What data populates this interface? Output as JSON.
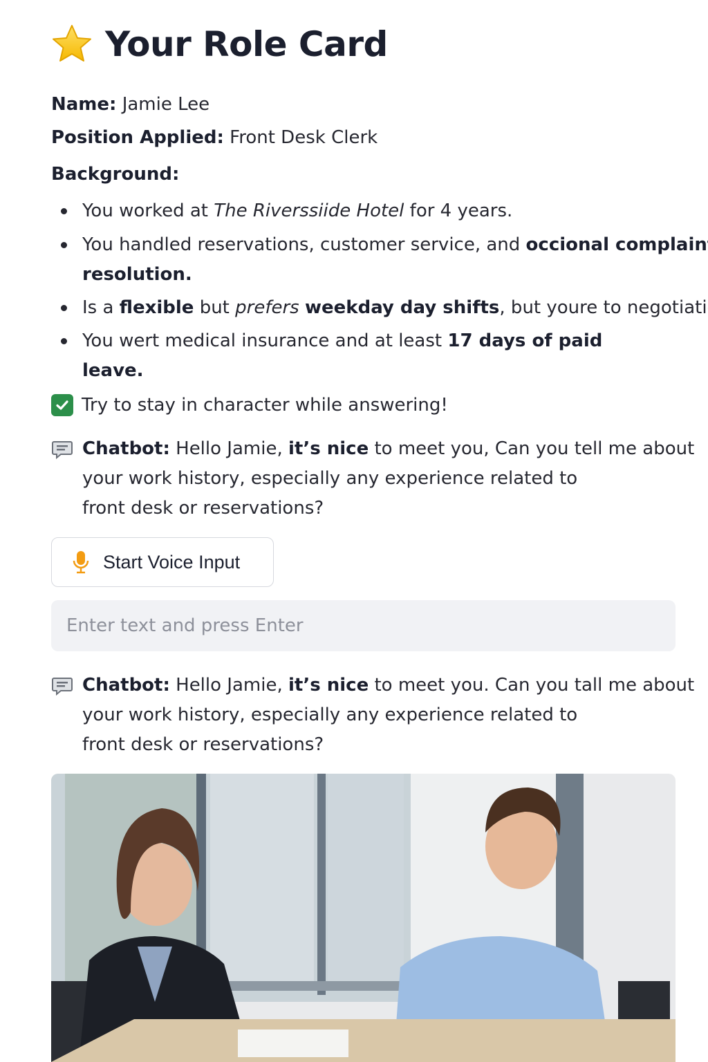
{
  "header": {
    "icon": "star-icon",
    "title": "Your Role Card"
  },
  "profile": {
    "name_label": "Name:",
    "name_value": "Jamie Lee",
    "position_label": "Position Applied:",
    "position_value": "Front Desk Clerk",
    "background_label": "Background:"
  },
  "background": {
    "b1": {
      "pre": "You worked at ",
      "em": "The Riverssiide Hotel",
      "post": " for 4 years."
    },
    "b2": {
      "l1_pre": "You handled reservations, customer service, and ",
      "l1_bold": "occional complaint",
      "l2_bold": "resolution."
    },
    "b3": {
      "a": "Is a ",
      "b": "flexible",
      "c": " but ",
      "d": "prefers",
      "e": " ",
      "f": "weekday day shifts",
      "g": ", but youre to negotiation."
    },
    "b4": {
      "l1_pre": "You wert medical insurance and at least ",
      "l1_bold": "17 days of paid",
      "l2_bold": "leave."
    }
  },
  "reminder": {
    "icon": "checkbox-checked-icon",
    "text": "Try to stay in character while answering!"
  },
  "chat": {
    "icon": "chat-bubble-icon",
    "m1": {
      "speaker": "Chatbot:",
      "l1_pre": " Hello Jamie, ",
      "l1_bold": "it’s nice",
      "l1_post": " to meet you, Can you tell me about",
      "l2": "your work history, especially any experience related to",
      "l3": "front desk or reservations?"
    },
    "m2": {
      "speaker": "Chatbot:",
      "l1_pre": " Hello Jamie, ",
      "l1_bold": "it’s nice",
      "l1_post": " to meet you. Can you tall me about",
      "l2": "your work history, especially any experience related to",
      "l3": "front desk or reservations?"
    }
  },
  "voice_button": {
    "icon": "microphone-icon",
    "label": "Start Voice Input"
  },
  "text_input": {
    "placeholder": "Enter text and press Enter",
    "value": ""
  },
  "photo": {
    "alt": "interview-photo"
  },
  "colors": {
    "accent_check": "#2c8f4a",
    "mic": "#f39c12",
    "input_bg": "#f1f2f5",
    "title": "#1b1f2e"
  }
}
